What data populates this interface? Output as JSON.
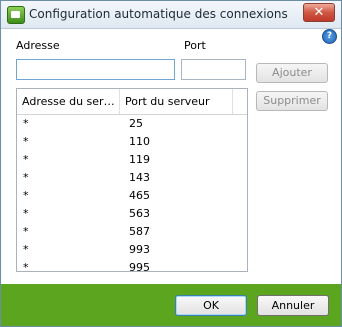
{
  "window": {
    "title": "Configuration automatique des connexions"
  },
  "form": {
    "address_label": "Adresse",
    "port_label": "Port",
    "address_value": "",
    "port_value": "",
    "add_label": "Ajouter",
    "remove_label": "Supprimer"
  },
  "list": {
    "columns": [
      "Adresse du serveur",
      "Port du serveur"
    ],
    "rows": [
      [
        "*",
        "25"
      ],
      [
        "*",
        "110"
      ],
      [
        "*",
        "119"
      ],
      [
        "*",
        "143"
      ],
      [
        "*",
        "465"
      ],
      [
        "*",
        "563"
      ],
      [
        "*",
        "587"
      ],
      [
        "*",
        "993"
      ],
      [
        "*",
        "995"
      ]
    ]
  },
  "footer": {
    "ok_label": "OK",
    "cancel_label": "Annuler"
  }
}
